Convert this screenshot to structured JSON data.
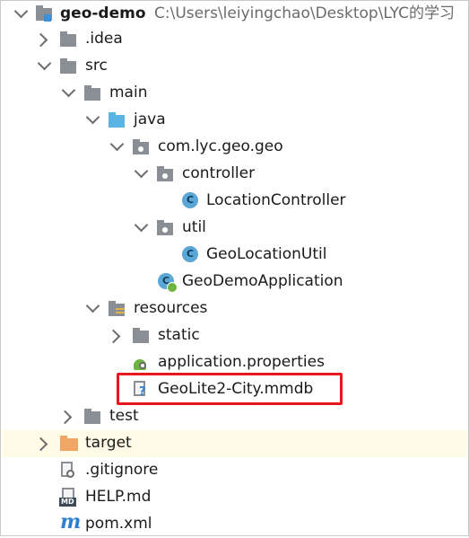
{
  "project": {
    "name": "geo-demo",
    "path": "C:\\Users\\leiyingchao\\Desktop\\LYC的学习"
  },
  "tree": {
    "idea": ".idea",
    "src": "src",
    "main": "main",
    "java": "java",
    "package": "com.lyc.geo.geo",
    "controller": "controller",
    "location_controller": "LocationController",
    "util": "util",
    "geo_location_util": "GeoLocationUtil",
    "geo_demo_application": "GeoDemoApplication",
    "resources": "resources",
    "static": "static",
    "application_properties": "application.properties",
    "geolite": "GeoLite2-City.mmdb",
    "test": "test",
    "target": "target",
    "gitignore": ".gitignore",
    "help_md": "HELP.md",
    "pom": "pom.xml"
  },
  "icon_labels": {
    "class": "C",
    "md": "MD",
    "maven": "m"
  },
  "colors": {
    "highlight": "#fffbe6",
    "annotation": "#e8161d",
    "folder": "#8a8f95",
    "source_folder": "#5ab4e6",
    "target_folder": "#f0a766",
    "class_icon": "#5aa6d4"
  }
}
